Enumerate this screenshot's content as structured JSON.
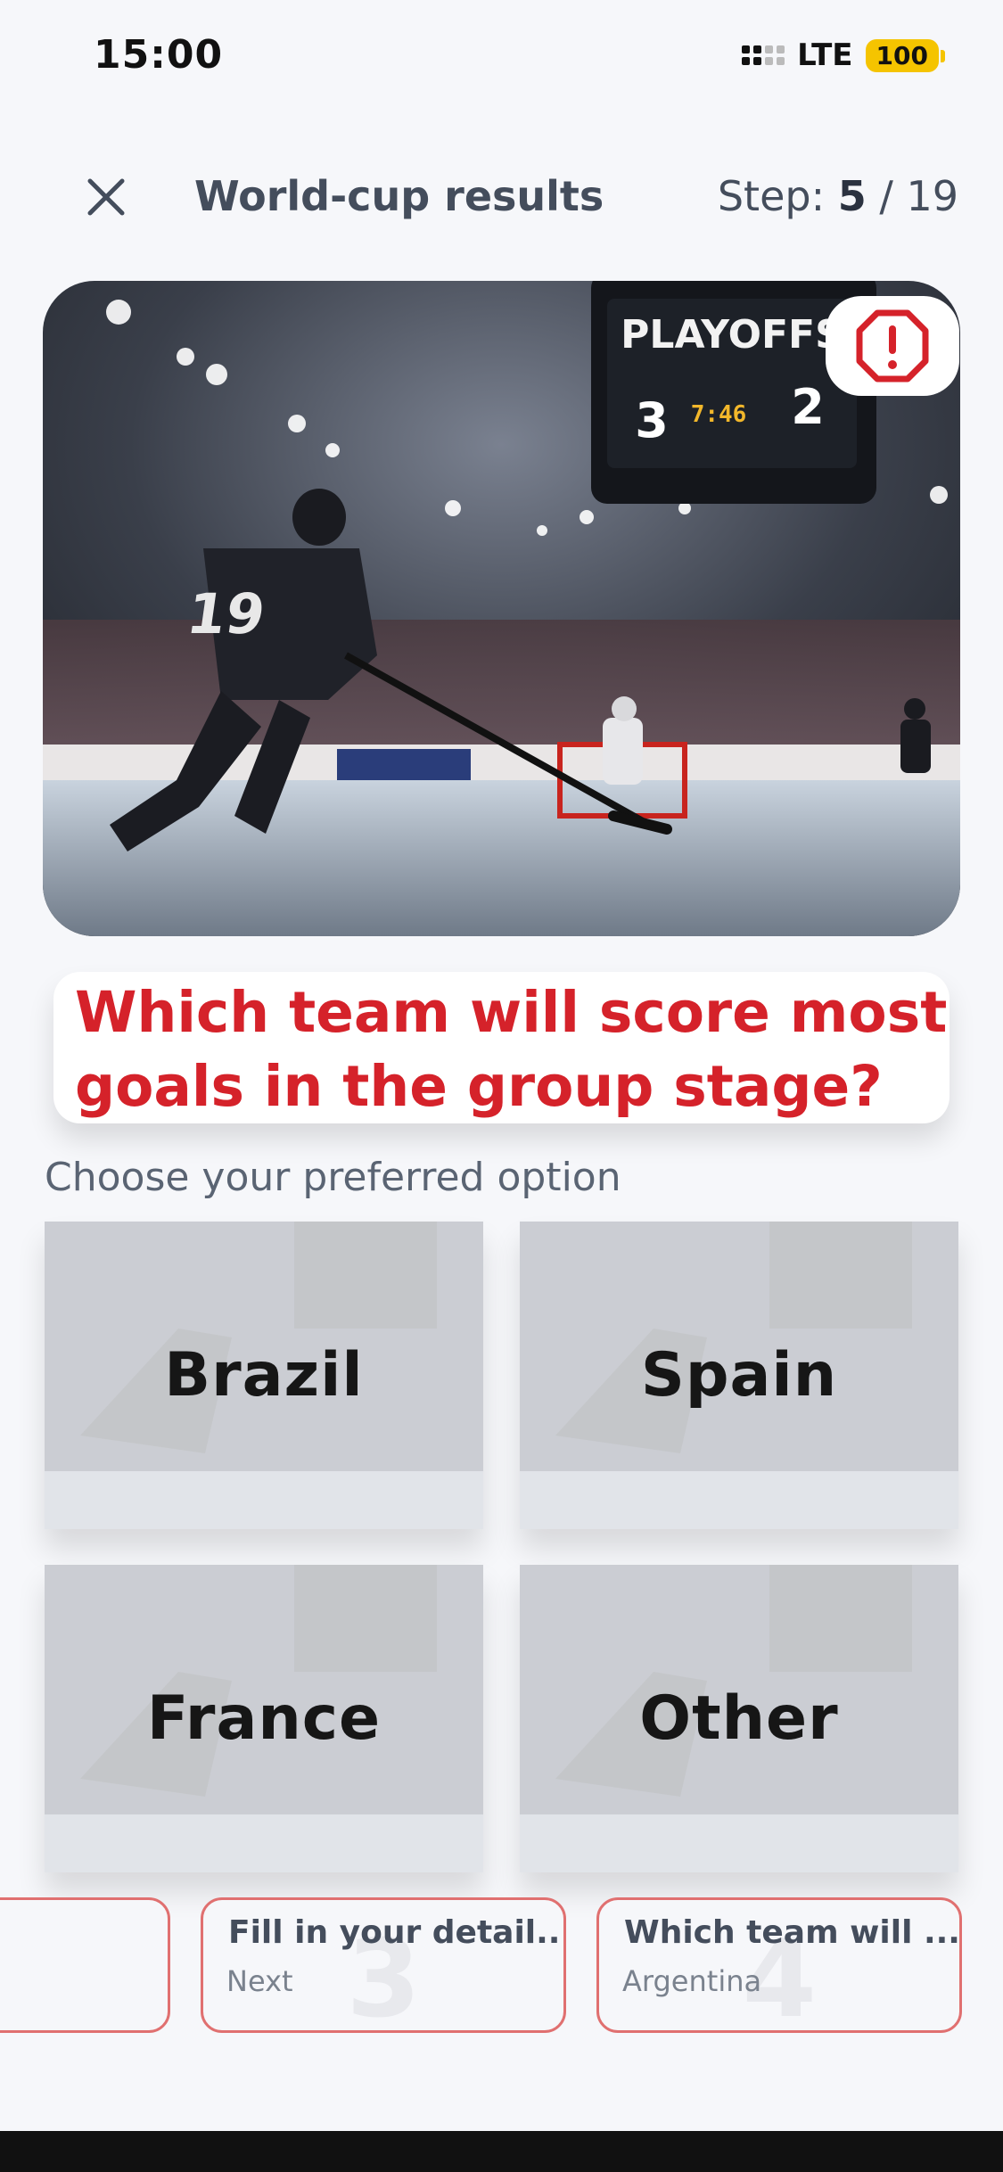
{
  "status": {
    "time": "15:00",
    "network": "LTE",
    "battery": "100"
  },
  "header": {
    "title": "World-cup results",
    "step_label": "Step:",
    "step_current": "5",
    "step_sep": " / ",
    "step_total": "19"
  },
  "hero": {
    "board_title": "PLAYOFFS",
    "score_home": "3",
    "score_away": "2",
    "clock": "7:46",
    "jersey": "19"
  },
  "question": {
    "text": "Which team will score most goals in the group stage?",
    "prompt": "Choose your preferred option"
  },
  "options": [
    {
      "label": "Brazil"
    },
    {
      "label": "Spain"
    },
    {
      "label": "France"
    },
    {
      "label": "Other"
    }
  ],
  "steps": [
    {
      "title": "",
      "subtitle": "",
      "number": ""
    },
    {
      "title": "Fill in your detail...",
      "subtitle": "Next",
      "number": "3"
    },
    {
      "title": "Which team will ...",
      "subtitle": "Argentina",
      "number": "4"
    }
  ],
  "icons": {
    "close": "close-icon",
    "report": "alert-octagon-icon",
    "signal": "signal-icon"
  },
  "colors": {
    "accent": "#d5222a",
    "battery": "#f5c400",
    "step_border": "#e07070"
  }
}
